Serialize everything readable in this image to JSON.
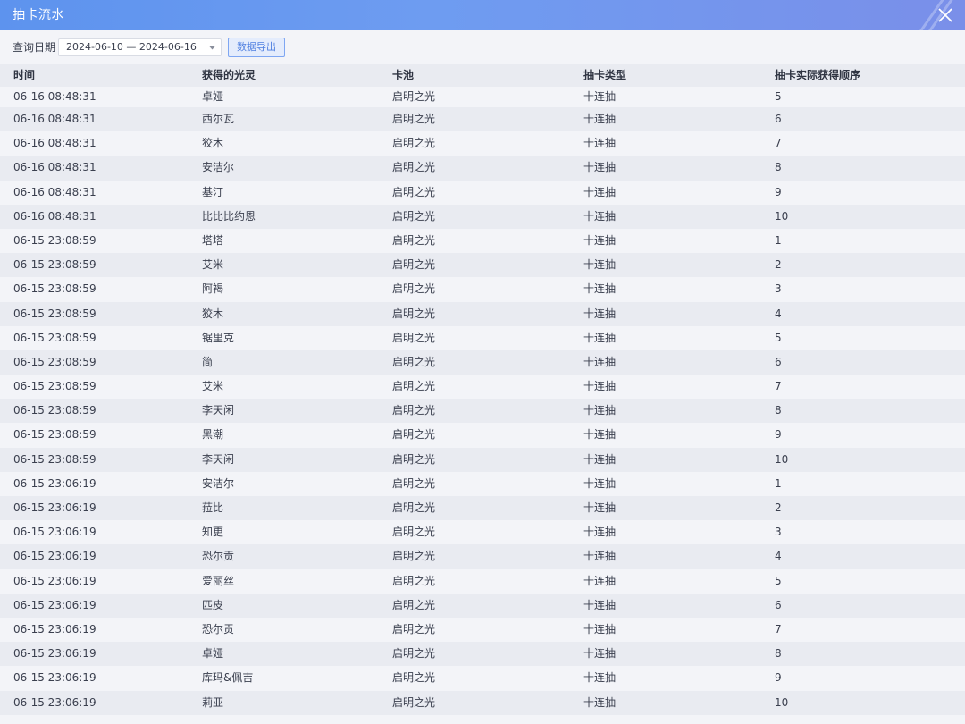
{
  "window": {
    "title": "抽卡流水",
    "close_icon": "close-icon"
  },
  "toolbar": {
    "query_label": "查询日期",
    "date_range": "2024-06-10 — 2024-06-16",
    "export_label": "数据导出"
  },
  "table": {
    "headers": [
      "时间",
      "获得的光灵",
      "卡池",
      "抽卡类型",
      "抽卡实际获得顺序"
    ],
    "rows": [
      [
        "06-16 08:48:31",
        "卓娅",
        "启明之光",
        "十连抽",
        "5"
      ],
      [
        "06-16 08:48:31",
        "西尔瓦",
        "启明之光",
        "十连抽",
        "6"
      ],
      [
        "06-16 08:48:31",
        "狡木",
        "启明之光",
        "十连抽",
        "7"
      ],
      [
        "06-16 08:48:31",
        "安洁尔",
        "启明之光",
        "十连抽",
        "8"
      ],
      [
        "06-16 08:48:31",
        "基汀",
        "启明之光",
        "十连抽",
        "9"
      ],
      [
        "06-16 08:48:31",
        "比比比约恩",
        "启明之光",
        "十连抽",
        "10"
      ],
      [
        "06-15 23:08:59",
        "塔塔",
        "启明之光",
        "十连抽",
        "1"
      ],
      [
        "06-15 23:08:59",
        "艾米",
        "启明之光",
        "十连抽",
        "2"
      ],
      [
        "06-15 23:08:59",
        "阿褐",
        "启明之光",
        "十连抽",
        "3"
      ],
      [
        "06-15 23:08:59",
        "狡木",
        "启明之光",
        "十连抽",
        "4"
      ],
      [
        "06-15 23:08:59",
        "锯里克",
        "启明之光",
        "十连抽",
        "5"
      ],
      [
        "06-15 23:08:59",
        "简",
        "启明之光",
        "十连抽",
        "6"
      ],
      [
        "06-15 23:08:59",
        "艾米",
        "启明之光",
        "十连抽",
        "7"
      ],
      [
        "06-15 23:08:59",
        "李天闲",
        "启明之光",
        "十连抽",
        "8"
      ],
      [
        "06-15 23:08:59",
        "黑潮",
        "启明之光",
        "十连抽",
        "9"
      ],
      [
        "06-15 23:08:59",
        "李天闲",
        "启明之光",
        "十连抽",
        "10"
      ],
      [
        "06-15 23:06:19",
        "安洁尔",
        "启明之光",
        "十连抽",
        "1"
      ],
      [
        "06-15 23:06:19",
        "菈比",
        "启明之光",
        "十连抽",
        "2"
      ],
      [
        "06-15 23:06:19",
        "知更",
        "启明之光",
        "十连抽",
        "3"
      ],
      [
        "06-15 23:06:19",
        "恐尔贡",
        "启明之光",
        "十连抽",
        "4"
      ],
      [
        "06-15 23:06:19",
        "爱丽丝",
        "启明之光",
        "十连抽",
        "5"
      ],
      [
        "06-15 23:06:19",
        "匹皮",
        "启明之光",
        "十连抽",
        "6"
      ],
      [
        "06-15 23:06:19",
        "恐尔贡",
        "启明之光",
        "十连抽",
        "7"
      ],
      [
        "06-15 23:06:19",
        "卓娅",
        "启明之光",
        "十连抽",
        "8"
      ],
      [
        "06-15 23:06:19",
        "库玛&佩吉",
        "启明之光",
        "十连抽",
        "9"
      ],
      [
        "06-15 23:06:19",
        "莉亚",
        "启明之光",
        "十连抽",
        "10"
      ]
    ]
  },
  "colors": {
    "title_gradient_start": "#5d93ee",
    "title_gradient_end": "#7a8fe9",
    "accent": "#4f7fe0",
    "row_alt": "#e9ebf1",
    "background": "#f3f4f8"
  }
}
